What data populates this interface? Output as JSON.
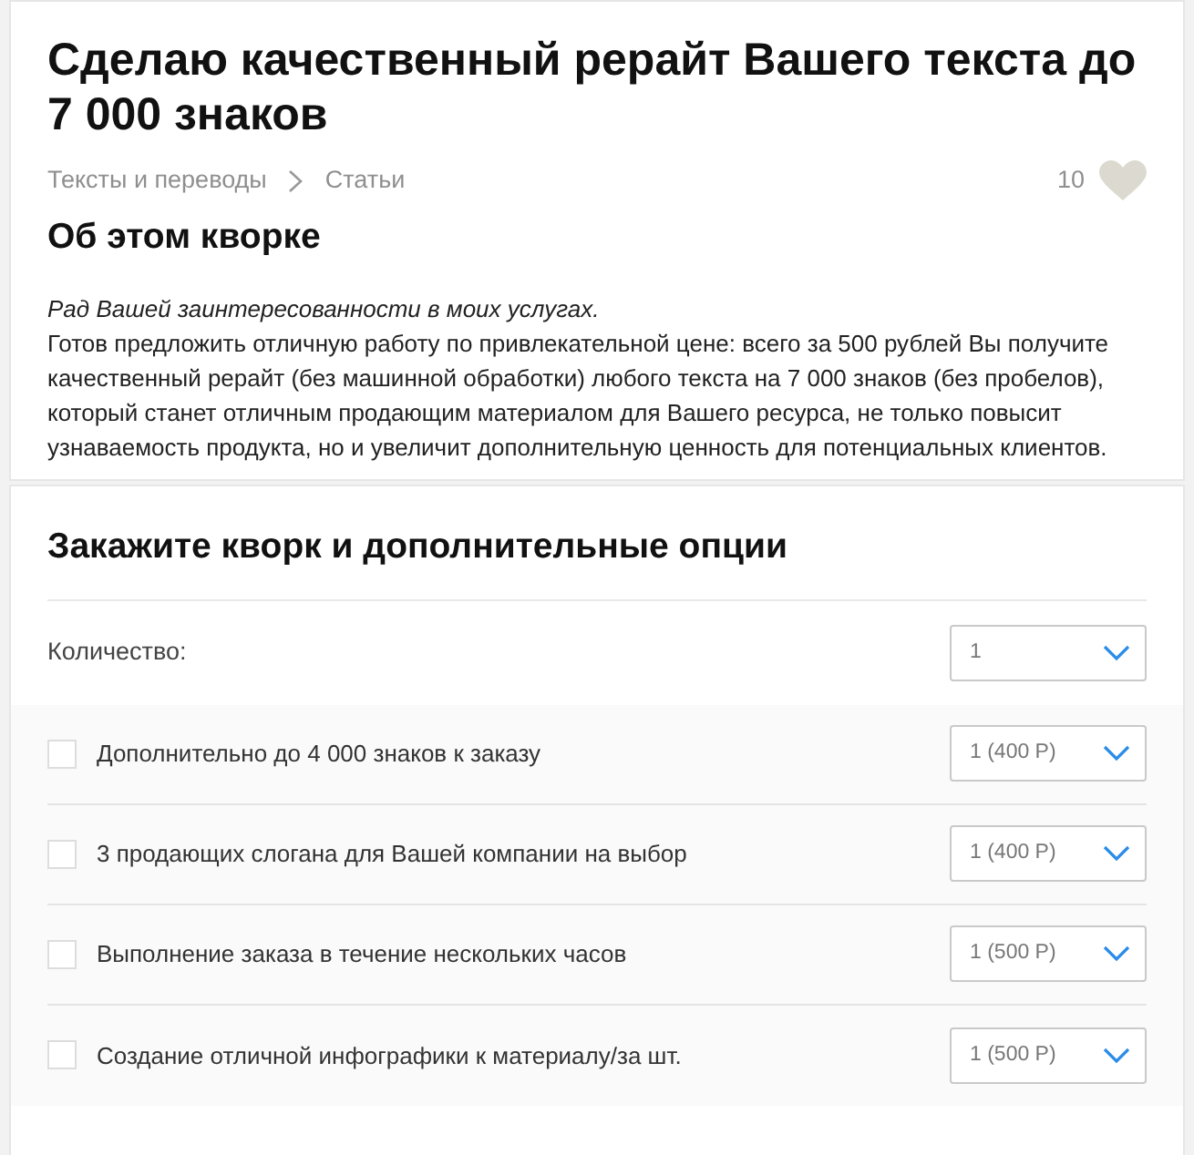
{
  "title": "Сделаю качественный рерайт Вашего текста до 7 000 знаков",
  "breadcrumbs": [
    {
      "label": "Тексты и переводы"
    },
    {
      "label": "Статьи"
    }
  ],
  "favorites": {
    "count": "10",
    "selected": false
  },
  "about": {
    "heading": "Об этом кворке",
    "intro": "Рад Вашей заинтересованности в моих услугах.",
    "body": "Готов предложить отличную работу по привлекательной цене: всего за 500 рублей Вы получите качественный рерайт (без машинной обработки) любого текста на 7 000 знаков (без пробелов), который станет отличным продающим материалом для Вашего ресурса, не только повысит узнаваемость продукта, но и увеличит дополнительную ценность для потенциальных клиентов."
  },
  "order": {
    "heading": "Закажите кворк и дополнительные опции",
    "quantity": {
      "label": "Количество:",
      "value": "1"
    },
    "options": [
      {
        "label": "Дополнительно до 4 000 знаков к заказу",
        "value": "1 (400 Р)",
        "checked": false
      },
      {
        "label": "3 продающих слогана для Вашей компании на выбор",
        "value": "1 (400 Р)",
        "checked": false
      },
      {
        "label": "Выполнение заказа в течение нескольких часов",
        "value": "1 (500 Р)",
        "checked": false
      },
      {
        "label": "Создание отличной инфографики к материалу/за шт.",
        "value": "1 (500 Р)",
        "checked": false
      }
    ]
  }
}
